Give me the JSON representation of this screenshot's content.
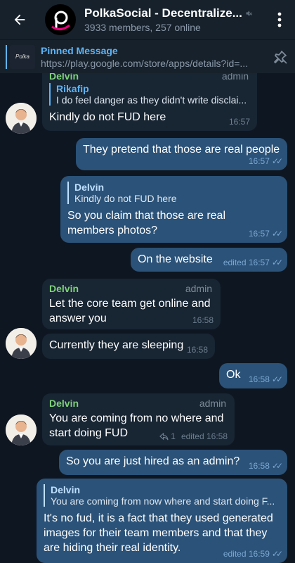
{
  "header": {
    "title": "PolkaSocial - Decentralize...",
    "subtitle": "3933 members, 257 online",
    "back_icon": "arrow-left-icon",
    "mute_icon": "muted-icon",
    "more_icon": "more-vertical-icon"
  },
  "pinned": {
    "title": "Pinned Message",
    "body": "https://play.google.com/store/apps/details?id=...",
    "thumb_text": "Polka",
    "icon": "unpin-icon"
  },
  "messages": {
    "m1": {
      "sender": "Delvin",
      "role": "admin",
      "reply_name": "Rikafip",
      "reply_text": "I do feel danger as they didn't write disclai...",
      "text": "Kindly do not FUD here",
      "time": "16:57"
    },
    "m2": {
      "text": "They pretend that those are real people",
      "time": "16:57"
    },
    "m3": {
      "reply_name": "Delvin",
      "reply_text": "Kindly do not FUD here",
      "text": "So you claim that those are real members photos?",
      "time": "16:57"
    },
    "m4": {
      "text": "On the website",
      "time": "edited 16:57"
    },
    "m5": {
      "sender": "Delvin",
      "role": "admin",
      "text": "Let the core team get online and answer you",
      "time": "16:58"
    },
    "m6": {
      "text": "Currently they are sleeping",
      "time": "16:58"
    },
    "m7": {
      "text": "Ok",
      "time": "16:58"
    },
    "m8": {
      "sender": "Delvin",
      "role": "admin",
      "text": "You are coming from no where and start doing FUD",
      "replies": "1",
      "time": "edited 16:58"
    },
    "m9": {
      "text": "So you are just hired as an admin?",
      "time": "16:58"
    },
    "m10": {
      "reply_name": "Delvin",
      "reply_text": "You are coming from now where and start doing F...",
      "text": "It's no fud, it is a fact that they used generated images for their team members and that they are hiding their real identity.",
      "time": "edited 16:59"
    }
  },
  "colors": {
    "background": "#0e1621",
    "header": "#17212b",
    "incoming": "#182533",
    "outgoing": "#2b5278",
    "accent": "#5eb5f7",
    "sender": "#7fd27a"
  }
}
